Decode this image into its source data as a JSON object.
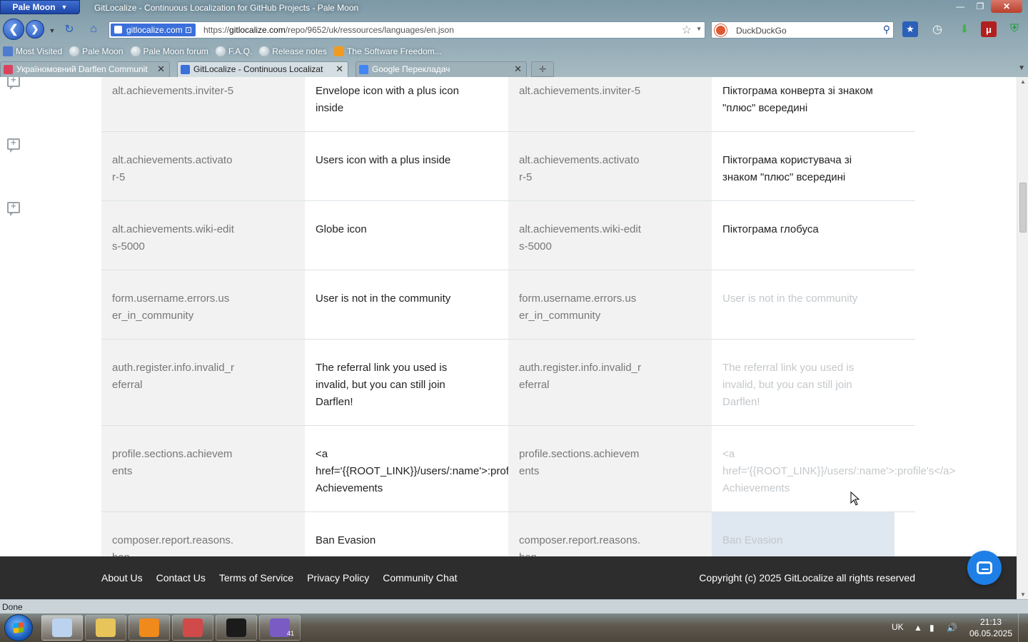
{
  "browser": {
    "app_menu": "Pale Moon",
    "window_title": "GitLocalize - Continuous Localization for GitHub Projects - Pale Moon",
    "identity_label": "gitlocalize.com",
    "url_prefix": "https://",
    "url_domain": "gitlocalize.com",
    "url_path": "/repo/9652/uk/ressources/languages/en.json",
    "search_placeholder": "DuckDuckGo",
    "bookmarks": [
      {
        "label": "Most Visited"
      },
      {
        "label": "Pale Moon"
      },
      {
        "label": "Pale Moon forum"
      },
      {
        "label": "F.A.Q."
      },
      {
        "label": "Release notes"
      },
      {
        "label": "The Software Freedom..."
      }
    ],
    "tabs": [
      {
        "label": "Україномовний Darflen Communit",
        "active": false,
        "favicon_color": "#d9435f"
      },
      {
        "label": "GitLocalize - Continuous Localizat",
        "active": true,
        "favicon_color": "#3b6fd9"
      },
      {
        "label": "Google Перекладач",
        "active": false,
        "favicon_color": "#4285f4"
      }
    ],
    "status": "Done"
  },
  "rows": [
    {
      "key": "alt.achievements.inviter-5",
      "source": "Envelope icon with a plus icon inside",
      "key2": "alt.achievements.inviter-5",
      "target": "Піктограма конверта зі знаком \"плюс\" всередині",
      "state": "translated"
    },
    {
      "key": "alt.achievements.activator-5",
      "source": "Users icon with a plus inside",
      "key2": "alt.achievements.activator-5",
      "target": "Піктограма користувача зі знаком \"плюс\" всередині",
      "state": "translated"
    },
    {
      "key": "alt.achievements.wiki-edits-5000",
      "source": "Globe icon",
      "key2": "alt.achievements.wiki-edits-5000",
      "target": "Піктограма глобуса",
      "state": "translated"
    },
    {
      "key": "form.username.errors.user_in_community",
      "source": "User is not in the community",
      "key2": "form.username.errors.user_in_community",
      "target": "User is not in the community",
      "state": "untranslated"
    },
    {
      "key": "auth.register.info.invalid_referral",
      "source": "The referral link you used is invalid, but you can still join Darflen!",
      "key2": "auth.register.info.invalid_referral",
      "target": "The referral link you used is invalid, but you can still join Darflen!",
      "state": "untranslated"
    },
    {
      "key": "profile.sections.achievements",
      "source": "<a href='{{ROOT_LINK}}/users/:name'>:profile's</a> Achievements",
      "key2": "profile.sections.achievements",
      "target": "<a href='{{ROOT_LINK}}/users/:name'>:profile's</a> Achievements",
      "state": "untranslated"
    },
    {
      "key": "composer.report.reasons.ban",
      "source": "Ban Evasion",
      "key2": "composer.report.reasons.ban",
      "target": "Ban Evasion",
      "state": "selected"
    }
  ],
  "footer": {
    "links": [
      "About Us",
      "Contact Us",
      "Terms of Service",
      "Privacy Policy",
      "Community Chat"
    ],
    "copyright": "Copyright (c) 2025 GitLocalize all rights reserved"
  },
  "taskbar": {
    "apps": [
      {
        "name": "pale-moon",
        "color": "#bcd3f0",
        "active": true,
        "badge": ""
      },
      {
        "name": "file-explorer",
        "color": "#e8c55a",
        "active": false,
        "badge": ""
      },
      {
        "name": "media-player",
        "color": "#f08a1c",
        "active": false,
        "badge": ""
      },
      {
        "name": "installer",
        "color": "#d04a4a",
        "active": false,
        "badge": ""
      },
      {
        "name": "text-editor",
        "color": "#1b1b1b",
        "active": false,
        "badge": ""
      },
      {
        "name": "moon-app",
        "color": "#7a5bc4",
        "active": false,
        "badge": "41"
      }
    ],
    "language": "UK",
    "time": "21:13",
    "date": "06.05.2025"
  }
}
